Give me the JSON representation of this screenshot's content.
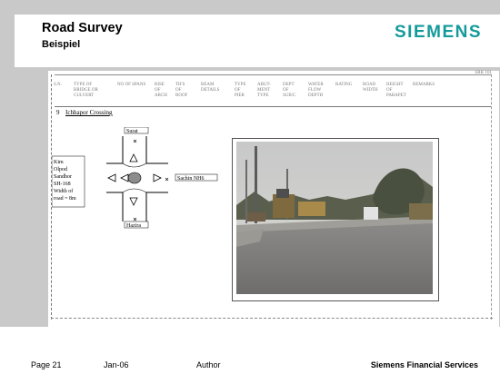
{
  "header": {
    "title": "Road Survey",
    "subtitle": "Beispiel",
    "logo": "SIEMENS"
  },
  "doc": {
    "page_ref": "SRK 101",
    "columns": [
      "S.N.",
      "TYPE OF\nBRIDGE OR\nCULVERT",
      "NO OF SPANS",
      "RISE\nOF\nARCH",
      "TH'S\nOF\nROOF",
      "BEAM\nDETAILS",
      "TYPE\nOF\nPIER",
      "ABUT-\nMENT\nTYPE",
      "DEPT\nOF\nSUB/C",
      "WATER\nFLOW\nDEPTH",
      "RATING",
      "ROAD\nWIDTH",
      "HEIGHT\nOF\nPARAPET",
      "REMARKS"
    ],
    "row_number": "9",
    "crossing_name": "Ichhapor Crossing",
    "sketch": {
      "north_label": "Surat",
      "east_label": "Sachin NH6",
      "south_label": "Hazira",
      "west_lines": [
        "Kim",
        "Olpod",
        "Sandhor",
        "SH-168",
        "Width of",
        "road = 8m"
      ]
    }
  },
  "footer": {
    "page": "Page 21",
    "date": "Jan-06",
    "author": "Author",
    "company": "Siemens Financial Services"
  },
  "colors": {
    "logo": "#139a9a",
    "slide_bg": "#c9c9c9"
  }
}
